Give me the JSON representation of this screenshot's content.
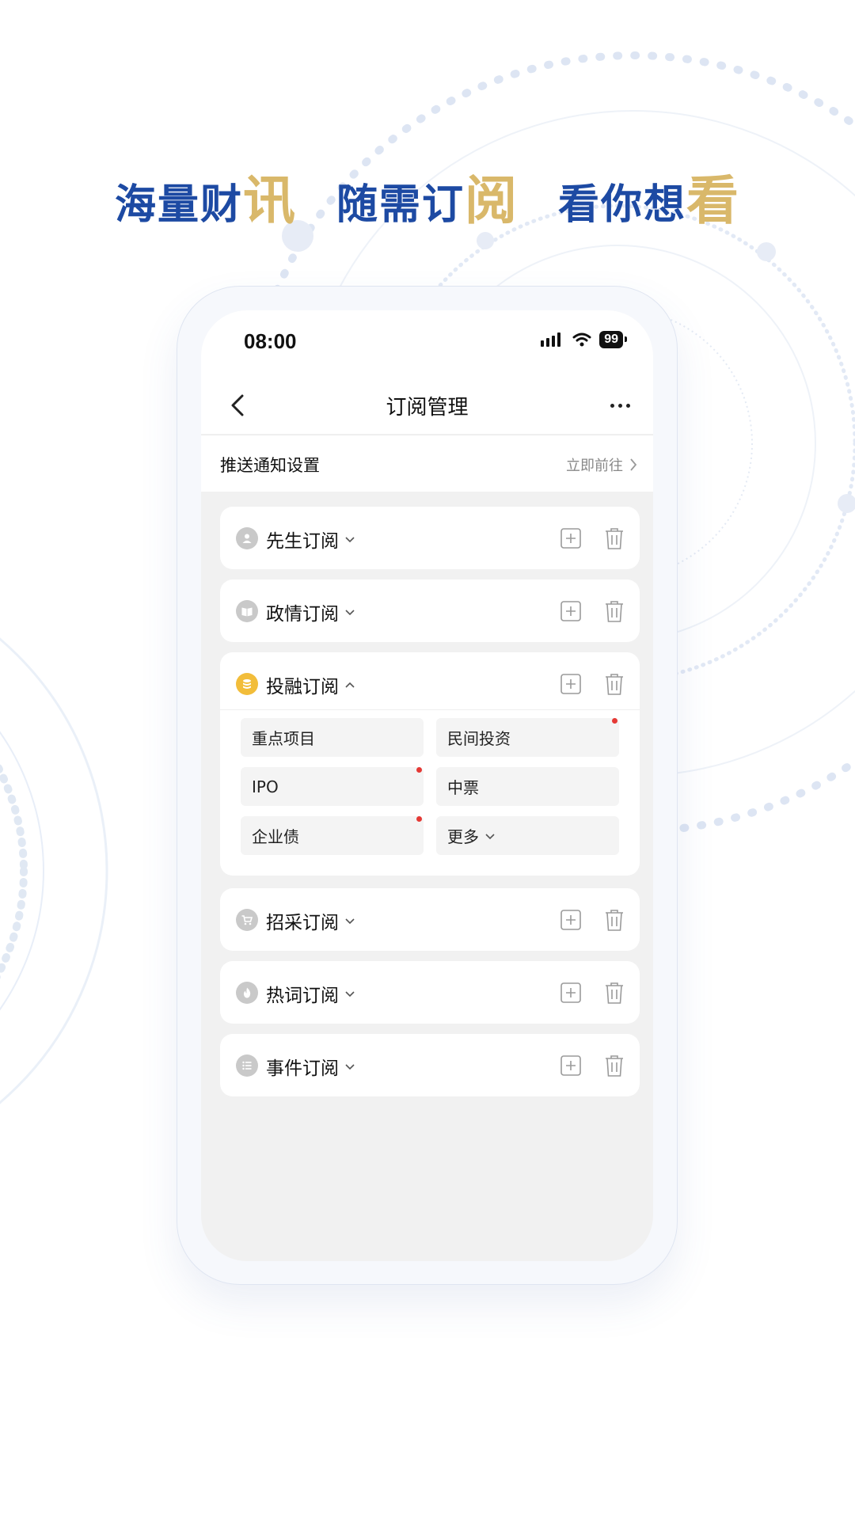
{
  "headline": [
    {
      "main": "海量财",
      "accent": "讯"
    },
    {
      "main": "随需订",
      "accent": "阅"
    },
    {
      "main": "看你想",
      "accent": "看"
    }
  ],
  "colors": {
    "brand_blue": "#1d4aa3",
    "accent_gold": "#d9b86a",
    "alert_red": "#e53935",
    "active_icon": "#f2bd3a"
  },
  "status_bar": {
    "time": "08:00",
    "battery": "99"
  },
  "nav": {
    "title": "订阅管理",
    "back_icon": "chevron-left-icon",
    "more_icon": "more-dots-icon"
  },
  "push": {
    "label": "推送通知设置",
    "link": "立即前往"
  },
  "subscriptions": [
    {
      "name": "先生订阅",
      "icon": "person-icon",
      "expanded": false
    },
    {
      "name": "政情订阅",
      "icon": "book-icon",
      "expanded": false
    },
    {
      "name": "投融订阅",
      "icon": "coins-icon",
      "expanded": true,
      "items": [
        {
          "label": "重点项目",
          "dot": false
        },
        {
          "label": "民间投资",
          "dot": true
        },
        {
          "label": "IPO",
          "dot": true
        },
        {
          "label": "中票",
          "dot": false
        },
        {
          "label": "企业债",
          "dot": true
        },
        {
          "label": "更多",
          "dot": false
        }
      ]
    },
    {
      "name": "招采订阅",
      "icon": "cart-icon",
      "expanded": false
    },
    {
      "name": "热词订阅",
      "icon": "flame-icon",
      "expanded": false
    },
    {
      "name": "事件订阅",
      "icon": "list-icon",
      "expanded": false
    }
  ]
}
